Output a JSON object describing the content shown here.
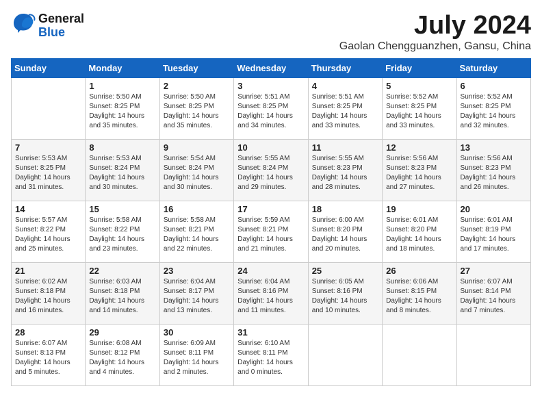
{
  "header": {
    "logo": {
      "general": "General",
      "blue": "Blue"
    },
    "month": "July 2024",
    "location": "Gaolan Chengguanzhen, Gansu, China"
  },
  "days_of_week": [
    "Sunday",
    "Monday",
    "Tuesday",
    "Wednesday",
    "Thursday",
    "Friday",
    "Saturday"
  ],
  "weeks": [
    [
      {
        "day": "",
        "info": ""
      },
      {
        "day": "1",
        "info": "Sunrise: 5:50 AM\nSunset: 8:25 PM\nDaylight: 14 hours\nand 35 minutes."
      },
      {
        "day": "2",
        "info": "Sunrise: 5:50 AM\nSunset: 8:25 PM\nDaylight: 14 hours\nand 35 minutes."
      },
      {
        "day": "3",
        "info": "Sunrise: 5:51 AM\nSunset: 8:25 PM\nDaylight: 14 hours\nand 34 minutes."
      },
      {
        "day": "4",
        "info": "Sunrise: 5:51 AM\nSunset: 8:25 PM\nDaylight: 14 hours\nand 33 minutes."
      },
      {
        "day": "5",
        "info": "Sunrise: 5:52 AM\nSunset: 8:25 PM\nDaylight: 14 hours\nand 33 minutes."
      },
      {
        "day": "6",
        "info": "Sunrise: 5:52 AM\nSunset: 8:25 PM\nDaylight: 14 hours\nand 32 minutes."
      }
    ],
    [
      {
        "day": "7",
        "info": "Sunrise: 5:53 AM\nSunset: 8:25 PM\nDaylight: 14 hours\nand 31 minutes."
      },
      {
        "day": "8",
        "info": "Sunrise: 5:53 AM\nSunset: 8:24 PM\nDaylight: 14 hours\nand 30 minutes."
      },
      {
        "day": "9",
        "info": "Sunrise: 5:54 AM\nSunset: 8:24 PM\nDaylight: 14 hours\nand 30 minutes."
      },
      {
        "day": "10",
        "info": "Sunrise: 5:55 AM\nSunset: 8:24 PM\nDaylight: 14 hours\nand 29 minutes."
      },
      {
        "day": "11",
        "info": "Sunrise: 5:55 AM\nSunset: 8:23 PM\nDaylight: 14 hours\nand 28 minutes."
      },
      {
        "day": "12",
        "info": "Sunrise: 5:56 AM\nSunset: 8:23 PM\nDaylight: 14 hours\nand 27 minutes."
      },
      {
        "day": "13",
        "info": "Sunrise: 5:56 AM\nSunset: 8:23 PM\nDaylight: 14 hours\nand 26 minutes."
      }
    ],
    [
      {
        "day": "14",
        "info": "Sunrise: 5:57 AM\nSunset: 8:22 PM\nDaylight: 14 hours\nand 25 minutes."
      },
      {
        "day": "15",
        "info": "Sunrise: 5:58 AM\nSunset: 8:22 PM\nDaylight: 14 hours\nand 23 minutes."
      },
      {
        "day": "16",
        "info": "Sunrise: 5:58 AM\nSunset: 8:21 PM\nDaylight: 14 hours\nand 22 minutes."
      },
      {
        "day": "17",
        "info": "Sunrise: 5:59 AM\nSunset: 8:21 PM\nDaylight: 14 hours\nand 21 minutes."
      },
      {
        "day": "18",
        "info": "Sunrise: 6:00 AM\nSunset: 8:20 PM\nDaylight: 14 hours\nand 20 minutes."
      },
      {
        "day": "19",
        "info": "Sunrise: 6:01 AM\nSunset: 8:20 PM\nDaylight: 14 hours\nand 18 minutes."
      },
      {
        "day": "20",
        "info": "Sunrise: 6:01 AM\nSunset: 8:19 PM\nDaylight: 14 hours\nand 17 minutes."
      }
    ],
    [
      {
        "day": "21",
        "info": "Sunrise: 6:02 AM\nSunset: 8:18 PM\nDaylight: 14 hours\nand 16 minutes."
      },
      {
        "day": "22",
        "info": "Sunrise: 6:03 AM\nSunset: 8:18 PM\nDaylight: 14 hours\nand 14 minutes."
      },
      {
        "day": "23",
        "info": "Sunrise: 6:04 AM\nSunset: 8:17 PM\nDaylight: 14 hours\nand 13 minutes."
      },
      {
        "day": "24",
        "info": "Sunrise: 6:04 AM\nSunset: 8:16 PM\nDaylight: 14 hours\nand 11 minutes."
      },
      {
        "day": "25",
        "info": "Sunrise: 6:05 AM\nSunset: 8:16 PM\nDaylight: 14 hours\nand 10 minutes."
      },
      {
        "day": "26",
        "info": "Sunrise: 6:06 AM\nSunset: 8:15 PM\nDaylight: 14 hours\nand 8 minutes."
      },
      {
        "day": "27",
        "info": "Sunrise: 6:07 AM\nSunset: 8:14 PM\nDaylight: 14 hours\nand 7 minutes."
      }
    ],
    [
      {
        "day": "28",
        "info": "Sunrise: 6:07 AM\nSunset: 8:13 PM\nDaylight: 14 hours\nand 5 minutes."
      },
      {
        "day": "29",
        "info": "Sunrise: 6:08 AM\nSunset: 8:12 PM\nDaylight: 14 hours\nand 4 minutes."
      },
      {
        "day": "30",
        "info": "Sunrise: 6:09 AM\nSunset: 8:11 PM\nDaylight: 14 hours\nand 2 minutes."
      },
      {
        "day": "31",
        "info": "Sunrise: 6:10 AM\nSunset: 8:11 PM\nDaylight: 14 hours\nand 0 minutes."
      },
      {
        "day": "",
        "info": ""
      },
      {
        "day": "",
        "info": ""
      },
      {
        "day": "",
        "info": ""
      }
    ]
  ]
}
